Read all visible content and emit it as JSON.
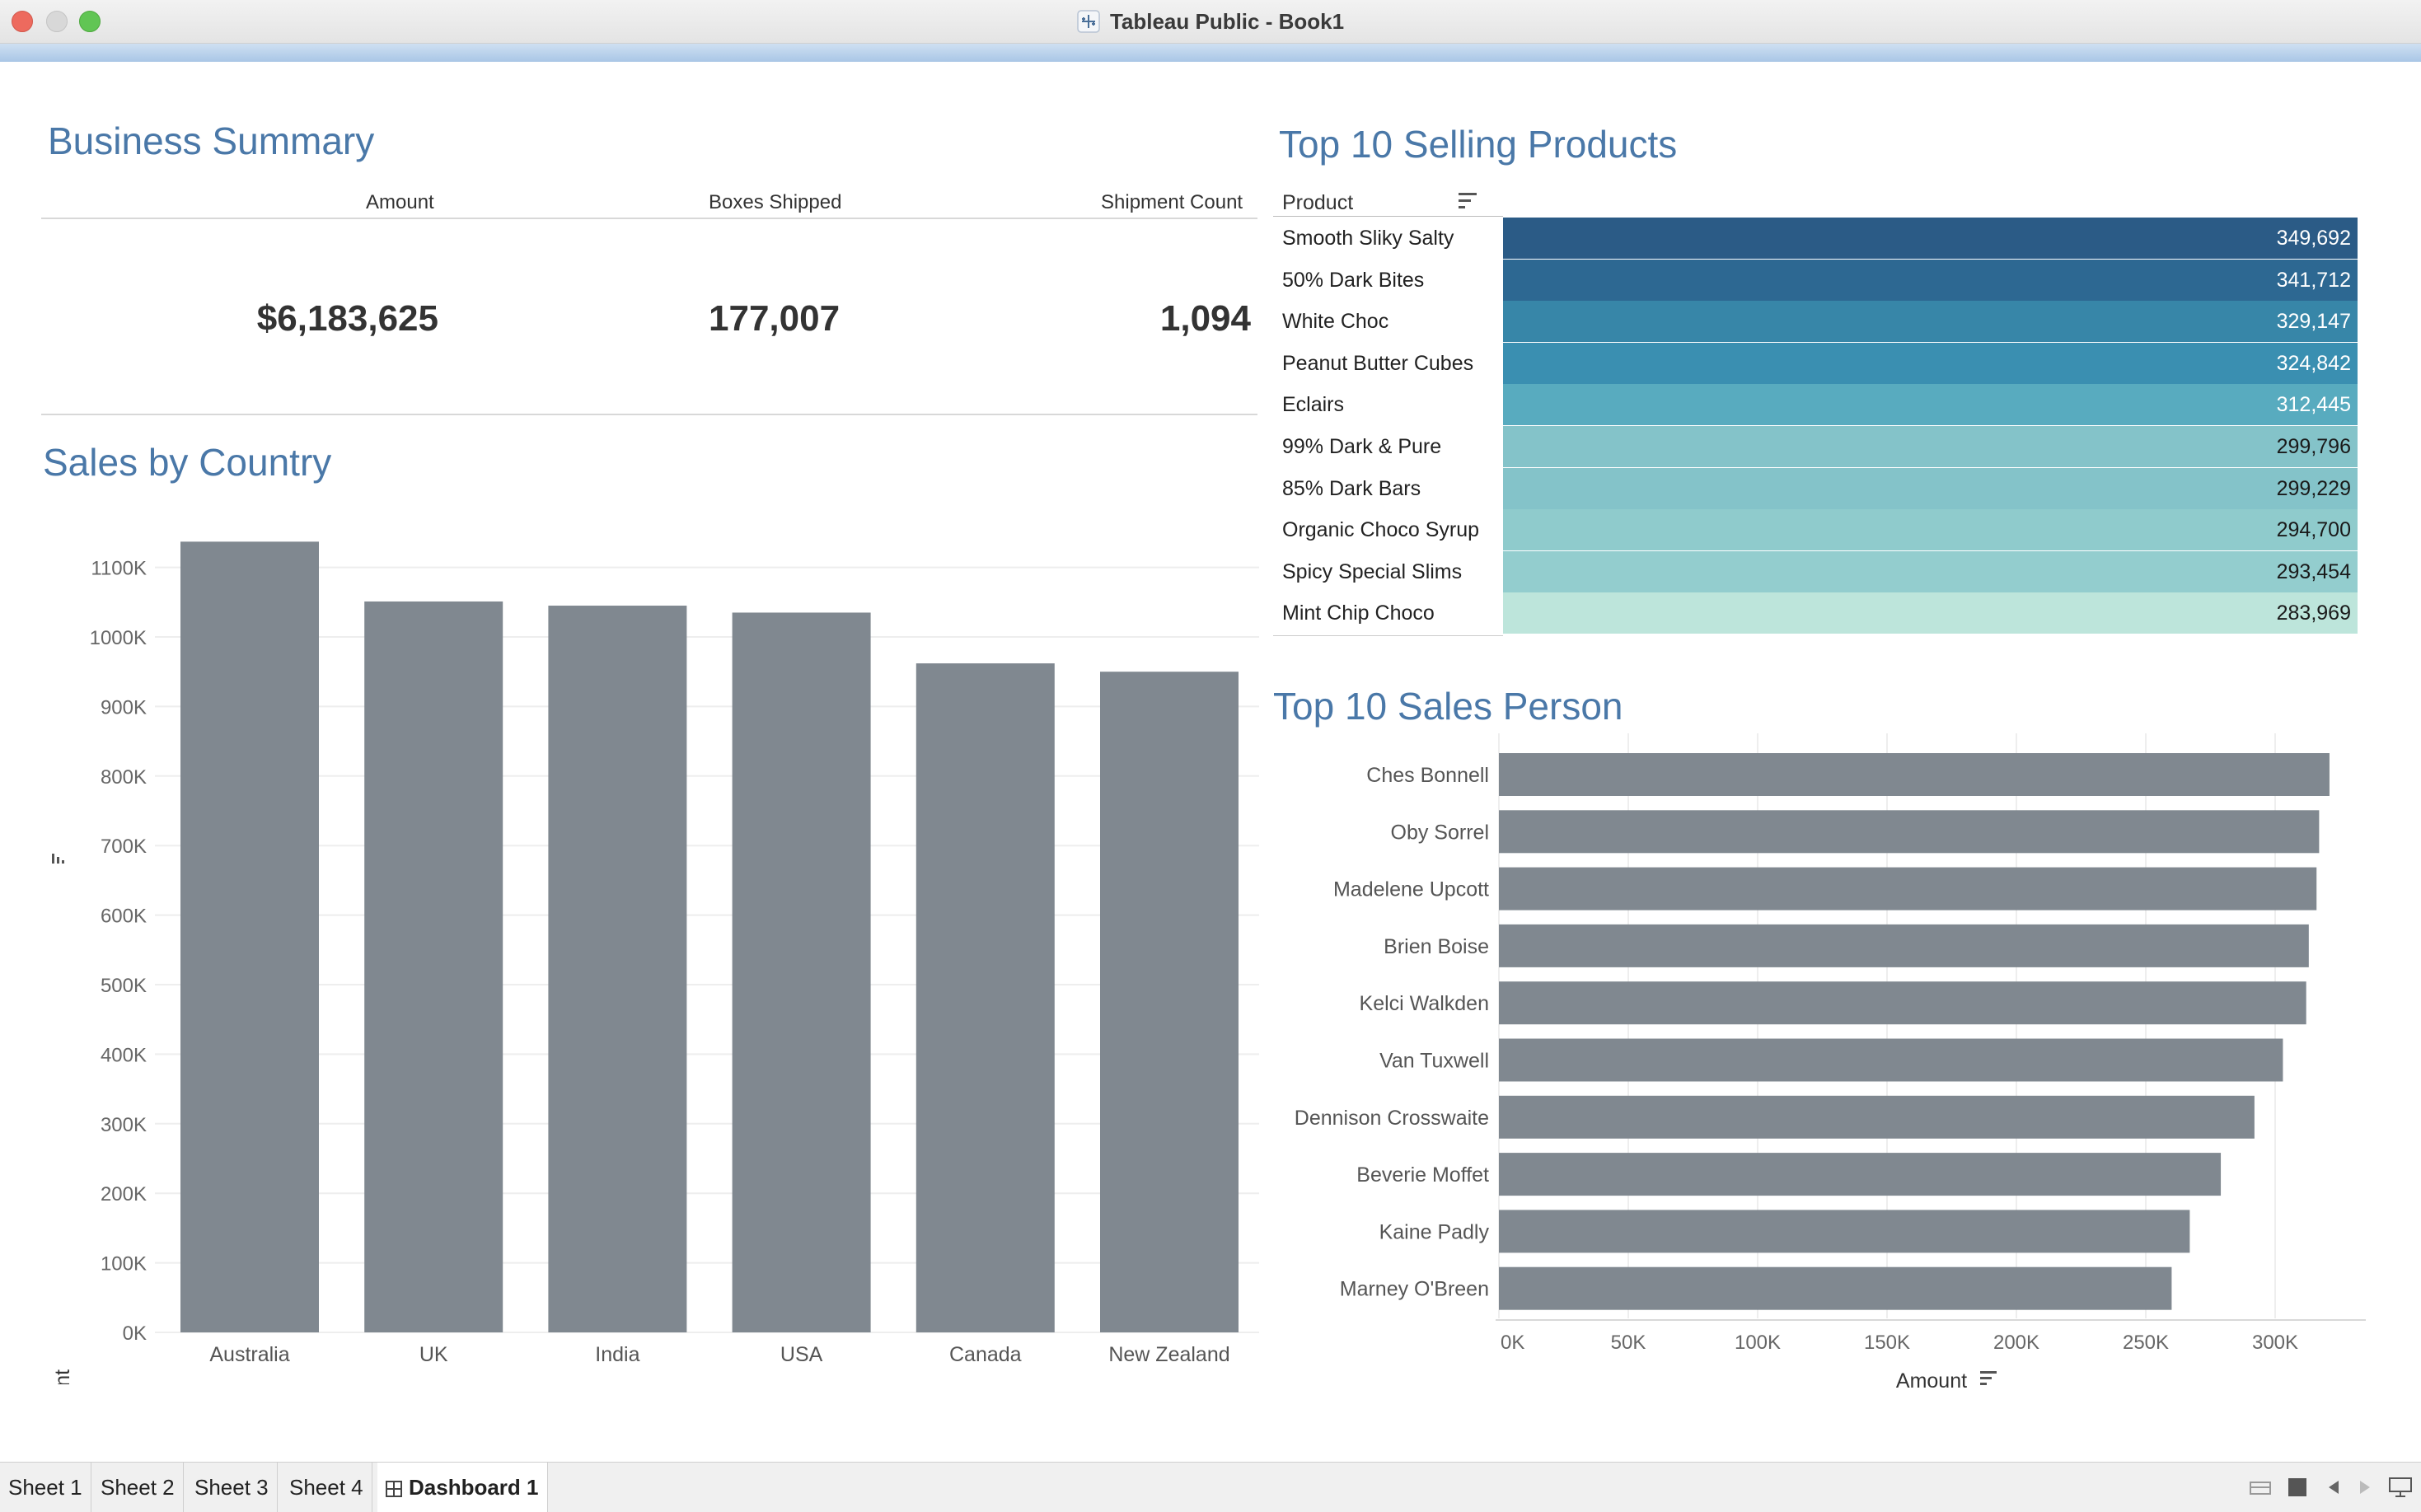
{
  "window": {
    "title": "Tableau Public - Book1"
  },
  "summary": {
    "title": "Business Summary",
    "headers": [
      "Amount",
      "Boxes Shipped",
      "Shipment Count"
    ],
    "values": [
      "$6,183,625",
      "177,007",
      "1,094"
    ]
  },
  "country_chart": {
    "title": "Sales by Country",
    "ylabel": "Amount",
    "yticks": [
      "0K",
      "100K",
      "200K",
      "300K",
      "400K",
      "500K",
      "600K",
      "700K",
      "800K",
      "900K",
      "1000K",
      "1100K"
    ]
  },
  "products": {
    "title": "Top 10 Selling Products",
    "header": "Product",
    "rows": [
      {
        "name": "Smooth Sliky Salty",
        "value": "349,692",
        "color": "#2b5b86"
      },
      {
        "name": "50% Dark Bites",
        "value": "341,712",
        "color": "#2d6892"
      },
      {
        "name": "White Choc",
        "value": "329,147",
        "color": "#3786a8"
      },
      {
        "name": "Peanut Butter Cubes",
        "value": "324,842",
        "color": "#3a8fb1"
      },
      {
        "name": "Eclairs",
        "value": "312,445",
        "color": "#58abbf"
      },
      {
        "name": "99% Dark & Pure",
        "value": "299,796",
        "color": "#84c3c9"
      },
      {
        "name": "85% Dark Bars",
        "value": "299,229",
        "color": "#84c3c9"
      },
      {
        "name": "Organic Choco Syrup",
        "value": "294,700",
        "color": "#8fcbcc"
      },
      {
        "name": "Spicy Special Slims",
        "value": "293,454",
        "color": "#93cdce"
      },
      {
        "name": "Mint Chip Choco",
        "value": "283,969",
        "color": "#bde5db"
      }
    ]
  },
  "salesperson_chart": {
    "title": "Top 10 Sales Person",
    "xlabel": "Amount",
    "xticks": [
      "0K",
      "50K",
      "100K",
      "150K",
      "200K",
      "250K",
      "300K"
    ]
  },
  "chart_data": [
    {
      "type": "bar",
      "title": "Sales by Country",
      "ylabel": "Amount",
      "categories": [
        "Australia",
        "UK",
        "India",
        "USA",
        "Canada",
        "New Zealand"
      ],
      "values": [
        1137000,
        1051000,
        1045000,
        1035000,
        962000,
        950000
      ],
      "ylim": [
        0,
        1150000
      ],
      "color": "#808890",
      "grid": true
    },
    {
      "type": "bar",
      "orientation": "horizontal",
      "title": "Top 10 Sales Person",
      "xlabel": "Amount",
      "categories": [
        "Ches Bonnell",
        "Oby Sorrel",
        "Madelene Upcott",
        "Brien Boise",
        "Kelci Walkden",
        "Van Tuxwell",
        "Dennison Crosswaite",
        "Beverie Moffet",
        "Kaine Padly",
        "Marney O'Breen"
      ],
      "values": [
        321000,
        317000,
        316000,
        313000,
        312000,
        303000,
        292000,
        279000,
        267000,
        260000
      ],
      "xlim": [
        0,
        335000
      ],
      "color": "#808890",
      "grid": true
    }
  ],
  "tabs": [
    "Sheet 1",
    "Sheet 2",
    "Sheet 3",
    "Sheet 4",
    "Dashboard 1"
  ]
}
